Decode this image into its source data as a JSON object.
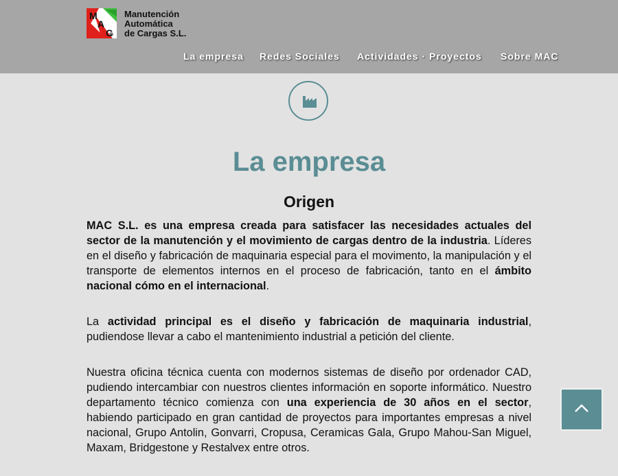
{
  "header": {
    "logo": {
      "mark_letters": [
        "M",
        "A",
        "C"
      ],
      "line1": "Manutención",
      "line2": "Automática",
      "line3": "de Cargas S.L."
    },
    "nav": [
      {
        "label": "La empresa"
      },
      {
        "label": "Redes Sociales"
      },
      {
        "label": "Actividades · Proyectos"
      },
      {
        "label": "Sobre MAC"
      }
    ]
  },
  "section": {
    "icon": "factory-icon",
    "title": "La empresa",
    "subtitle": "Origen"
  },
  "paragraphs": {
    "p1": {
      "b1": "MAC S.L. es una empresa creada para satisfacer las necesidades actuales del sector de la manutención y el movimiento de cargas dentro de la industria",
      "t1": ". Líderes en el diseño y fabricación de maquinaria especial para el movimento, la manipulación y el transporte de elementos internos en el proceso de fabricación, tanto en el ",
      "b2": "ámbito nacional cómo en el internacional",
      "t2": "."
    },
    "p2": {
      "t1": "La ",
      "b1": "actividad principal es el diseño y fabricación de maquinaria industrial",
      "t2": ", pudiendose llevar a cabo el mantenimiento industrial a petición del cliente."
    },
    "p3": {
      "t1": "Nuestra oficina técnica cuenta con modernos sistemas de diseño por ordenador CAD, pudiendo intercambiar con nuestros clientes información en soporte informático. Nuestro departamento técnico comienza con ",
      "b1": "una experiencia de 30 años en el sector",
      "t2": ", habiendo participado en gran cantidad de proyectos para importantes empresas a nivel nacional, Grupo Antolin, Gonvarri, Cropusa, Ceramicas Gala, Grupo Mahou-San Miguel, Maxam, Bridgestone y Restalvex entre otros."
    }
  },
  "scroll_top": {
    "icon": "chevron-up-icon"
  },
  "colors": {
    "header_bg": "#a6a6a6",
    "page_bg": "#e2e2e2",
    "accent": "#5a8d94",
    "logo_red": "#e0201b",
    "logo_green": "#3fbf3f"
  }
}
